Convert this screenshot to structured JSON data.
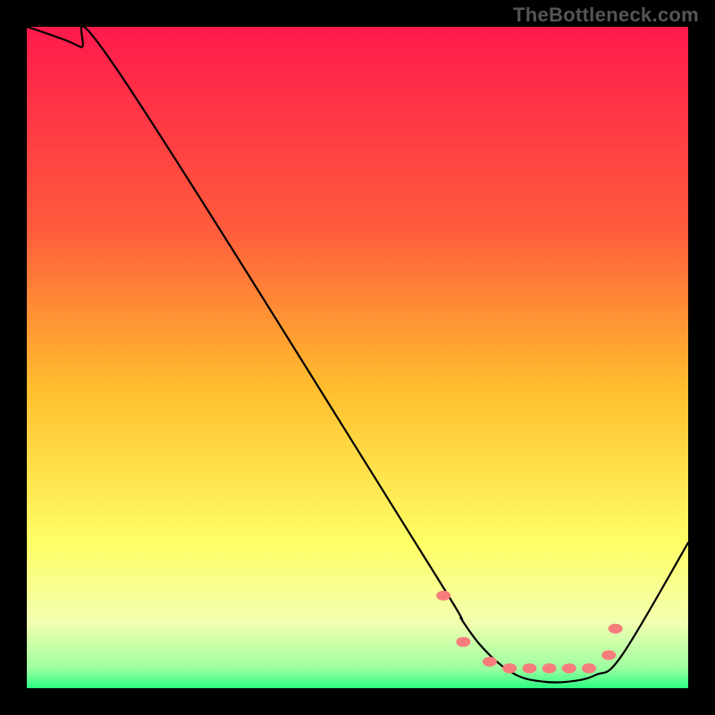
{
  "watermark": "TheBottleneck.com",
  "chart_data": {
    "type": "line",
    "title": "",
    "xlabel": "",
    "ylabel": "",
    "xlim": [
      0,
      100
    ],
    "ylim": [
      0,
      100
    ],
    "grid": false,
    "legend": false,
    "background_gradient_stops": [
      {
        "pct": 0,
        "color": "#ff1a4d"
      },
      {
        "pct": 30,
        "color": "#ff5a3c"
      },
      {
        "pct": 55,
        "color": "#ffbf2e"
      },
      {
        "pct": 78,
        "color": "#ffff66"
      },
      {
        "pct": 90,
        "color": "#f3ffb0"
      },
      {
        "pct": 97,
        "color": "#9dffa0"
      },
      {
        "pct": 100,
        "color": "#2bff82"
      }
    ],
    "series": [
      {
        "name": "bottleneck-curve",
        "x": [
          0,
          3,
          8,
          14,
          60,
          66,
          70,
          74,
          78,
          82,
          86,
          90,
          100
        ],
        "values": [
          100,
          99,
          97,
          93,
          20,
          10,
          5,
          2,
          1,
          1,
          2,
          5,
          22
        ]
      }
    ],
    "markers": {
      "name": "highlight-dots",
      "color": "#f77c7c",
      "x": [
        63,
        66,
        70,
        73,
        76,
        79,
        82,
        85,
        88,
        89
      ],
      "values": [
        14,
        7,
        4,
        3,
        3,
        3,
        3,
        3,
        5,
        9
      ]
    }
  }
}
